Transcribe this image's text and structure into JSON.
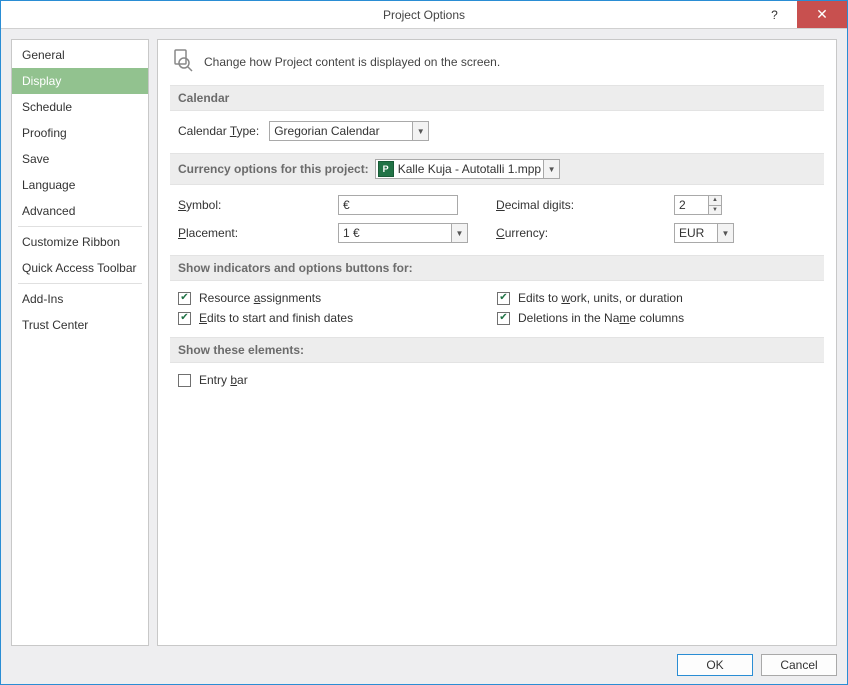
{
  "title": "Project Options",
  "titlebar": {
    "help_label": "?",
    "close_label": "✕"
  },
  "sidebar": {
    "items": [
      {
        "label": "General"
      },
      {
        "label": "Display",
        "selected": true
      },
      {
        "label": "Schedule"
      },
      {
        "label": "Proofing"
      },
      {
        "label": "Save"
      },
      {
        "label": "Language"
      },
      {
        "label": "Advanced"
      }
    ],
    "group2": [
      {
        "label": "Customize Ribbon"
      },
      {
        "label": "Quick Access Toolbar"
      }
    ],
    "group3": [
      {
        "label": "Add-Ins"
      },
      {
        "label": "Trust Center"
      }
    ]
  },
  "content": {
    "header": "Change how Project content is displayed on the screen.",
    "calendar": {
      "title": "Calendar",
      "type_label": "Calendar Type:",
      "type_value": "Gregorian Calendar"
    },
    "currency": {
      "title": "Currency options for this project:",
      "project_file": "Kalle Kuja - Autotalli 1.mpp",
      "symbol_label": "Symbol:",
      "symbol_value": "€",
      "placement_label": "Placement:",
      "placement_value": "1 €",
      "decimal_label": "Decimal digits:",
      "decimal_value": "2",
      "currency_label": "Currency:",
      "currency_value": "EUR"
    },
    "indicators": {
      "title": "Show indicators and options buttons for:",
      "resource": {
        "label": "Resource assignments",
        "checked": true
      },
      "work": {
        "label": "Edits to work, units, or duration",
        "checked": true
      },
      "dates": {
        "label": "Edits to start and finish dates",
        "checked": true
      },
      "deletions": {
        "label": "Deletions in the Name columns",
        "checked": true
      }
    },
    "elements": {
      "title": "Show these elements:",
      "entrybar": {
        "label": "Entry bar",
        "checked": false
      }
    }
  },
  "buttons": {
    "ok": "OK",
    "cancel": "Cancel"
  }
}
